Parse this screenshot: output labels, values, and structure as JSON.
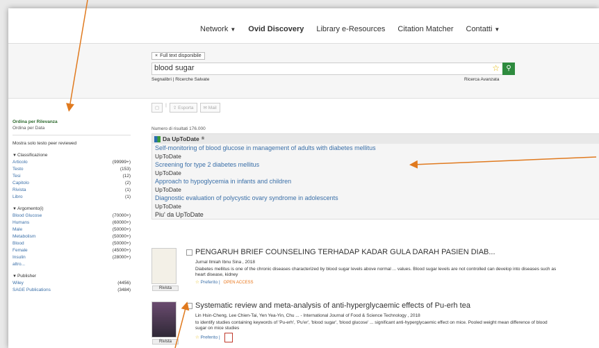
{
  "nav": {
    "items": [
      {
        "label": "Network",
        "caret": true
      },
      {
        "label": "Ovid Discovery",
        "active": true
      },
      {
        "label": "Library e-Resources"
      },
      {
        "label": "Citation Matcher"
      },
      {
        "label": "Contatti",
        "caret": true
      }
    ]
  },
  "search": {
    "chip": "Full text disponibile",
    "query": "blood sugar",
    "sublinks": "Segnalibri | Ricerche Salvate",
    "advanced": "Ricerca Avanzata"
  },
  "toolbar": {
    "export": "Esporta",
    "mail": "Mail"
  },
  "sidebar": {
    "sort_relevance": "Ordina per Rilevanza",
    "sort_date": "Ordina per Data",
    "peer": "Mostra solo testo peer reviewed",
    "facets": [
      {
        "title": "Classificazione",
        "rows": [
          {
            "label": "Articolo",
            "count": "(99999+)"
          },
          {
            "label": "Testo",
            "count": "(153)"
          },
          {
            "label": "Tesi",
            "count": "(12)"
          },
          {
            "label": "Capitolo",
            "count": "(2)"
          },
          {
            "label": "Rivista",
            "count": "(1)"
          },
          {
            "label": "Libro",
            "count": "(1)"
          }
        ]
      },
      {
        "title": "Argomento(i)",
        "rows": [
          {
            "label": "Blood Glucose",
            "count": "(70000+)"
          },
          {
            "label": "Humans",
            "count": "(60000+)"
          },
          {
            "label": "Male",
            "count": "(50000+)"
          },
          {
            "label": "Metabolism",
            "count": "(50000+)"
          },
          {
            "label": "Blood",
            "count": "(50000+)"
          },
          {
            "label": "Female",
            "count": "(45000+)"
          },
          {
            "label": "Insulin",
            "count": "(28000+)"
          },
          {
            "label": "altro...",
            "count": ""
          }
        ]
      },
      {
        "title": "Publisher",
        "rows": [
          {
            "label": "Wiley",
            "count": "(4456)"
          },
          {
            "label": "SAGE Publications",
            "count": "(3484)"
          }
        ]
      }
    ]
  },
  "results": {
    "count": "Numero di risultati 176.000",
    "uptodate_header": "Da UpToDate",
    "uptodate": [
      {
        "title": "Self-monitoring of blood glucose in management of adults with diabetes mellitus",
        "source": "UpToDate"
      },
      {
        "title": "Screening for type 2 diabetes mellitus",
        "source": "UpToDate"
      },
      {
        "title": "Approach to hypoglycemia in infants and children",
        "source": "UpToDate"
      },
      {
        "title": "Diagnostic evaluation of polycystic ovary syndrome in adolescents",
        "source": "UpToDate"
      }
    ],
    "uptodate_more": "Piu' da UpToDate",
    "items": [
      {
        "title": "PENGARUH BRIEF COUNSELING TERHADAP KADAR GULA DARAH PASIEN DIAB...",
        "meta": "Jurnal Ilmiah Ibnu Sina , 2018",
        "abstract": "Diabetes mellitus is one of the chronic diseases characterized by blood sugar levels above normal ... values. Blood sugar levels are not controlled can develop into diseases such as heart disease, kidney",
        "fav": "Preferito",
        "type": "Rivista",
        "badge": "OPEN ACCESS"
      },
      {
        "title": "Systematic review and meta-analysis of anti-hyperglycaemic effects of Pu-erh tea",
        "meta": "Lin Hsin-Cheng, Lee Chien-Tai, Yen Yea-Yin, Chu ... - International Journal of Food & Science Technology , 2018",
        "abstract": "to identify studies containing keywords of 'Pu-erh', 'Pu'er', 'blood sugar', 'blood glucose' ... significant anti-hyperglycaemic effect on mice. Pooled weight mean difference of blood sugar on mice studies",
        "fav": "Preferito",
        "type": "Rivista"
      }
    ]
  },
  "colors": {
    "accent_green": "#2e8b3e",
    "link_blue": "#3a6fa8",
    "arrow_orange": "#e07a1f"
  }
}
